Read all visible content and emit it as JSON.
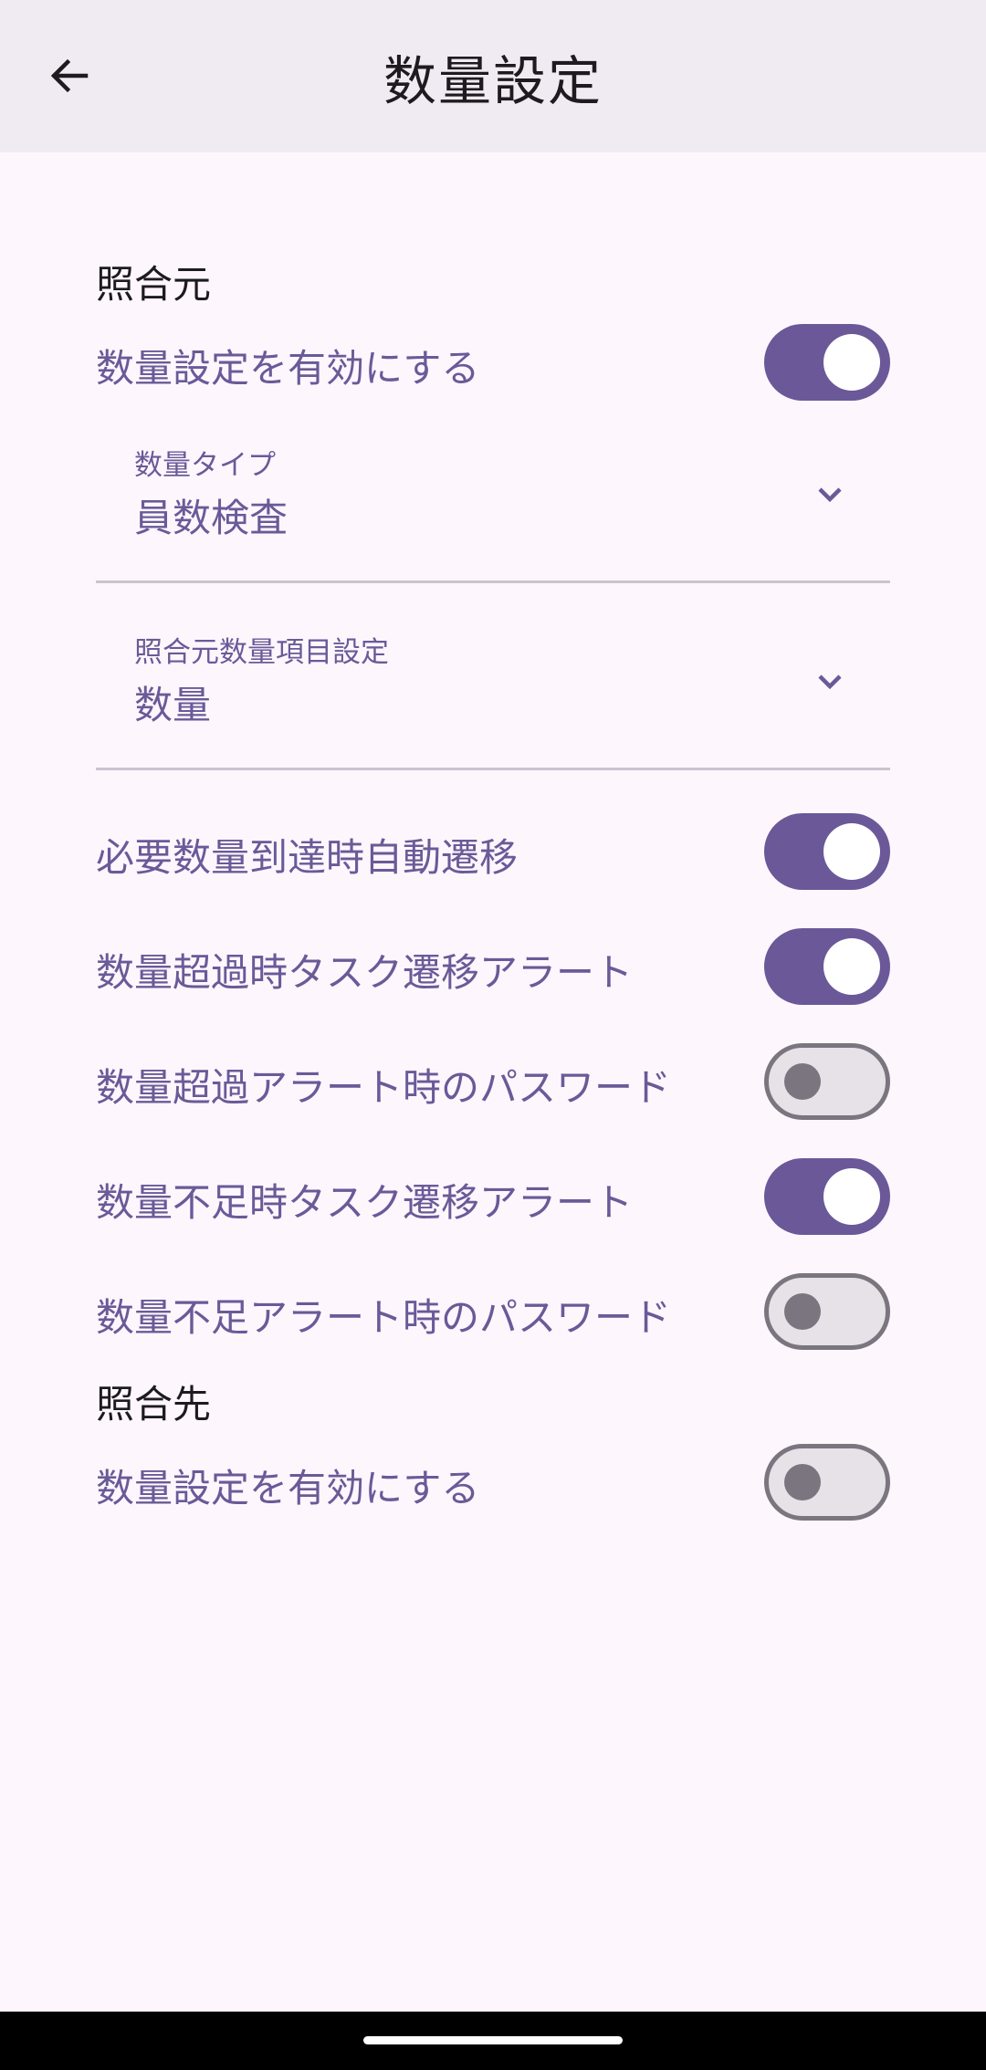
{
  "app": {
    "title": "数量設定"
  },
  "colors": {
    "accent": "#6a5898",
    "label_text": "#6a5a98",
    "background": "#fdf7fd",
    "appbar": "#f0ebf2"
  },
  "icons": {
    "back": "arrow-back-icon",
    "dropdown": "chevron-down-icon"
  },
  "source": {
    "header": "照合元",
    "enable": {
      "label": "数量設定を有効にする",
      "checked": true
    },
    "quantity_type": {
      "label": "数量タイプ",
      "value": "員数検査"
    },
    "quantity_item": {
      "label": "照合元数量項目設定",
      "value": "数量"
    },
    "auto_transition": {
      "label": "必要数量到達時自動遷移",
      "checked": true
    },
    "over_alert": {
      "label": "数量超過時タスク遷移アラート",
      "checked": true
    },
    "over_password": {
      "label": "数量超過アラート時のパスワード",
      "checked": false
    },
    "short_alert": {
      "label": "数量不足時タスク遷移アラート",
      "checked": true
    },
    "short_password": {
      "label": "数量不足アラート時のパスワード",
      "checked": false
    }
  },
  "target": {
    "header": "照合先",
    "enable": {
      "label": "数量設定を有効にする",
      "checked": false
    }
  }
}
